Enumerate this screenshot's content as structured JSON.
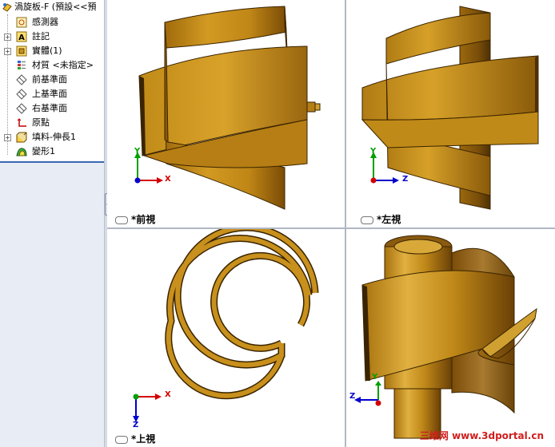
{
  "tree": {
    "root": "渦旋板-F  (預設<<預",
    "items": [
      {
        "label": "感測器",
        "icon": "sensor-icon"
      },
      {
        "label": "註記",
        "icon": "annotation-icon"
      },
      {
        "label": "實體(1)",
        "icon": "solid-body-icon"
      },
      {
        "label": "材質 <未指定>",
        "icon": "material-icon"
      },
      {
        "label": "前基準面",
        "icon": "plane-icon"
      },
      {
        "label": "上基準面",
        "icon": "plane-icon"
      },
      {
        "label": "右基準面",
        "icon": "plane-icon"
      },
      {
        "label": "原點",
        "icon": "origin-icon"
      },
      {
        "label": "填料-伸長1",
        "icon": "extrude-icon"
      },
      {
        "label": "變形1",
        "icon": "flex-icon"
      }
    ]
  },
  "viewports": {
    "front": {
      "label": "*前視"
    },
    "left": {
      "label": "*左視"
    },
    "top": {
      "label": "*上視"
    },
    "iso": {
      "label": ""
    }
  },
  "axes": {
    "x": "X",
    "y": "Y",
    "z": "Z"
  },
  "watermark": "三维网 www.3dportal.cn",
  "colors": {
    "gold": "#c8901c",
    "selection": "#3c68b4",
    "axis_red": "#d40000",
    "axis_green": "#00a000",
    "axis_blue": "#0000cc"
  }
}
